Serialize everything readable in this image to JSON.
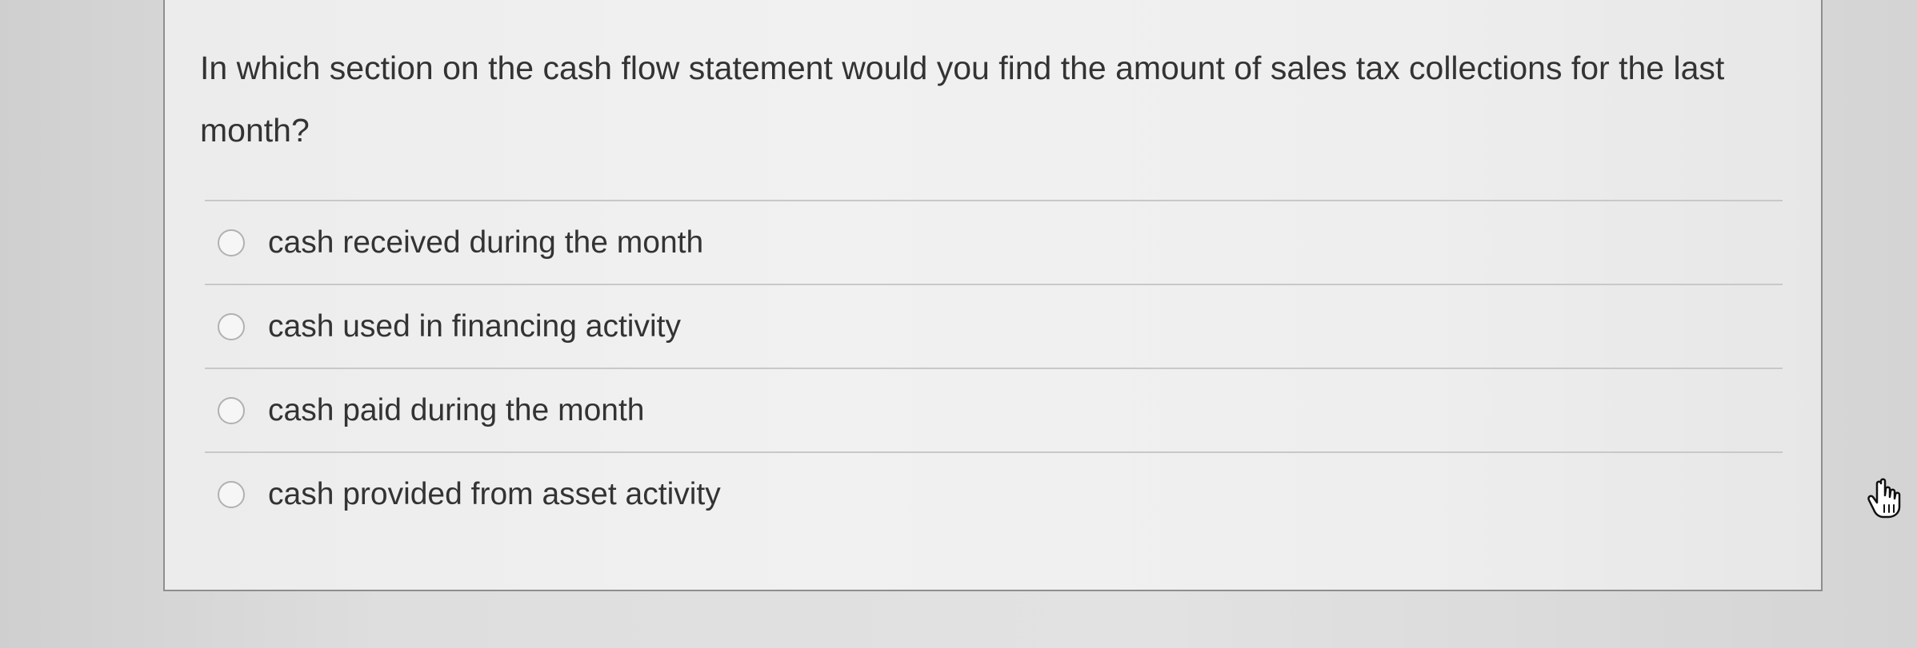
{
  "question": {
    "text": "In which section on the cash flow statement would you find the amount of sales tax collections for the last month?",
    "answers": [
      {
        "label": "cash received during the month",
        "selected": false
      },
      {
        "label": "cash used in financing activity",
        "selected": false
      },
      {
        "label": "cash paid during the month",
        "selected": false
      },
      {
        "label": "cash provided from asset activity",
        "selected": false
      }
    ]
  },
  "cursor": {
    "icon": "hand-pointer-icon"
  },
  "colors": {
    "card_background": "#f0f0f0",
    "text": "#333333",
    "divider": "#c8c8c8",
    "border": "#8e8e8e"
  }
}
